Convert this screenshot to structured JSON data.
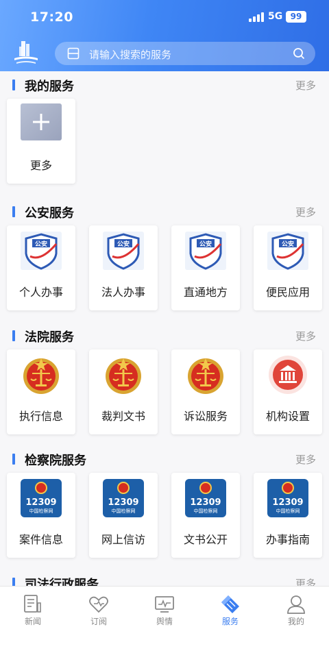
{
  "status": {
    "time": "17:20",
    "network": "5G",
    "battery": "99"
  },
  "search": {
    "placeholder": "请输入搜索的服务"
  },
  "sections": [
    {
      "title": "我的服务",
      "more": "更多",
      "items": [
        {
          "label": "更多",
          "icon": "add-icon"
        }
      ]
    },
    {
      "title": "公安服务",
      "more": "更多",
      "items": [
        {
          "label": "个人办事",
          "icon": "police-shield-icon",
          "badge": "公安"
        },
        {
          "label": "法人办事",
          "icon": "police-shield-icon",
          "badge": "公安"
        },
        {
          "label": "直通地方",
          "icon": "police-shield-icon",
          "badge": "公安"
        },
        {
          "label": "便民应用",
          "icon": "police-shield-icon",
          "badge": "公安"
        }
      ]
    },
    {
      "title": "法院服务",
      "more": "更多",
      "items": [
        {
          "label": "执行信息",
          "icon": "court-emblem-icon"
        },
        {
          "label": "裁判文书",
          "icon": "court-emblem-icon"
        },
        {
          "label": "诉讼服务",
          "icon": "court-emblem-icon"
        },
        {
          "label": "机构设置",
          "icon": "institution-building-icon"
        }
      ]
    },
    {
      "title": "检察院服务",
      "more": "更多",
      "items": [
        {
          "label": "案件信息",
          "icon": "procuratorate-12309-icon",
          "badge_num": "12309",
          "badge_text": "中国检察网"
        },
        {
          "label": "网上信访",
          "icon": "procuratorate-12309-icon",
          "badge_num": "12309",
          "badge_text": "中国检察网"
        },
        {
          "label": "文书公开",
          "icon": "procuratorate-12309-icon",
          "badge_num": "12309",
          "badge_text": "中国检察网"
        },
        {
          "label": "办事指南",
          "icon": "procuratorate-12309-icon",
          "badge_num": "12309",
          "badge_text": "中国检察网"
        }
      ]
    },
    {
      "title": "司法行政服务",
      "more": "更多",
      "items": []
    }
  ],
  "tabs": [
    {
      "label": "新闻",
      "icon": "news-icon",
      "active": false
    },
    {
      "label": "订阅",
      "icon": "heart-icon",
      "active": false
    },
    {
      "label": "舆情",
      "icon": "monitor-icon",
      "active": false
    },
    {
      "label": "服务",
      "icon": "service-icon",
      "active": true
    },
    {
      "label": "我的",
      "icon": "profile-icon",
      "active": false
    }
  ],
  "colors": {
    "accent": "#3b7ef0",
    "header_start": "#6aa8ff",
    "header_end": "#2f6ee6",
    "court_red": "#d62d20",
    "procuratorate_blue": "#1d5fa8"
  }
}
